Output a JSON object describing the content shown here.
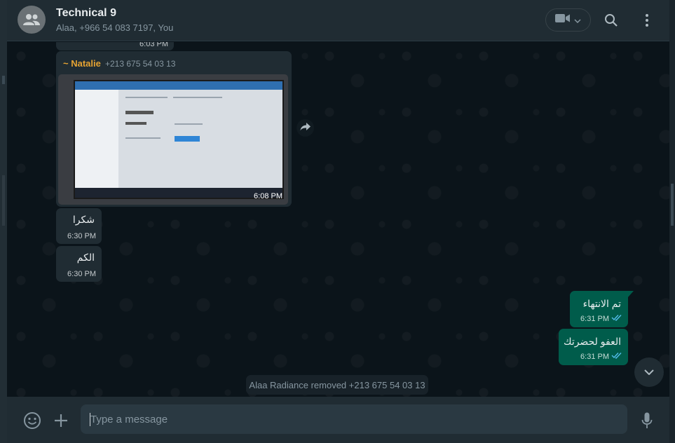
{
  "header": {
    "title": "Technical 9",
    "subtitle": "Alaa, +966 54 083 7197, You"
  },
  "messages": {
    "partial_time": "6:03 PM",
    "photo": {
      "sender": "~ Natalie",
      "sender_phone": "+213 675 54 03 13",
      "time": "6:08 PM"
    },
    "in1": {
      "text": "شكرا",
      "time": "6:30 PM"
    },
    "in2": {
      "text": "الكم",
      "time": "6:30 PM"
    },
    "out1": {
      "text": "تم الانتهاء",
      "time": "6:31 PM"
    },
    "out2": {
      "text": "العفو لحضرتك",
      "time": "6:31 PM"
    },
    "system": "Alaa Radiance removed +213 675 54 03 13"
  },
  "composer": {
    "placeholder": "Type a message"
  },
  "colors": {
    "header_bg": "#202c33",
    "chat_bg": "#0b141a",
    "incoming_bubble": "#202c33",
    "outgoing_bubble": "#005c4b",
    "sender_name": "#e5a333",
    "read_ticks": "#53bdeb"
  },
  "icons": [
    "group-avatar-icon",
    "video-call-icon",
    "chevron-down-icon",
    "search-icon",
    "menu-icon",
    "forward-icon",
    "double-check-icon",
    "scroll-down-icon",
    "emoji-icon",
    "attach-plus-icon",
    "microphone-icon"
  ]
}
